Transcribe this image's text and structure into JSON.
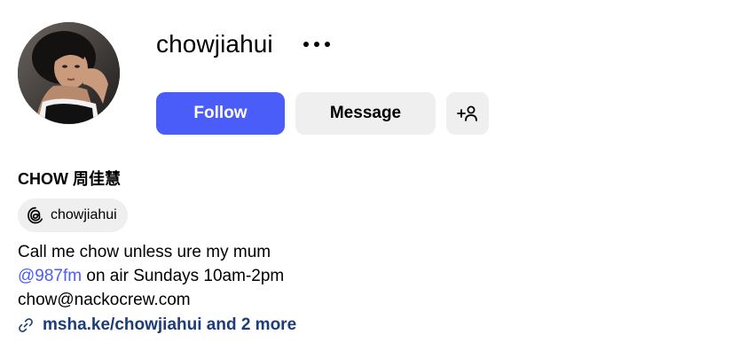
{
  "profile": {
    "username": "chowjiahui",
    "full_name": "CHOW 周佳慧",
    "avatar_icon": "profile-photo"
  },
  "actions": {
    "follow_label": "Follow",
    "message_label": "Message",
    "suggest_icon": "add-person-icon",
    "more_icon": "more-options-icon"
  },
  "threads": {
    "icon": "threads-icon",
    "handle": "chowjiahui"
  },
  "bio": {
    "line1": "Call me chow unless ure my mum",
    "mention": "@987fm",
    "line2_rest": " on air Sundays 10am-2pm",
    "line3": "chow@nackocrew.com"
  },
  "links": {
    "icon": "link-icon",
    "text": "msha.ke/chowjiahui and 2 more"
  },
  "colors": {
    "follow_button": "#4a5df9",
    "secondary_button": "#efeff0",
    "mention": "#4a5df9",
    "link_text": "#1c3d7a"
  }
}
